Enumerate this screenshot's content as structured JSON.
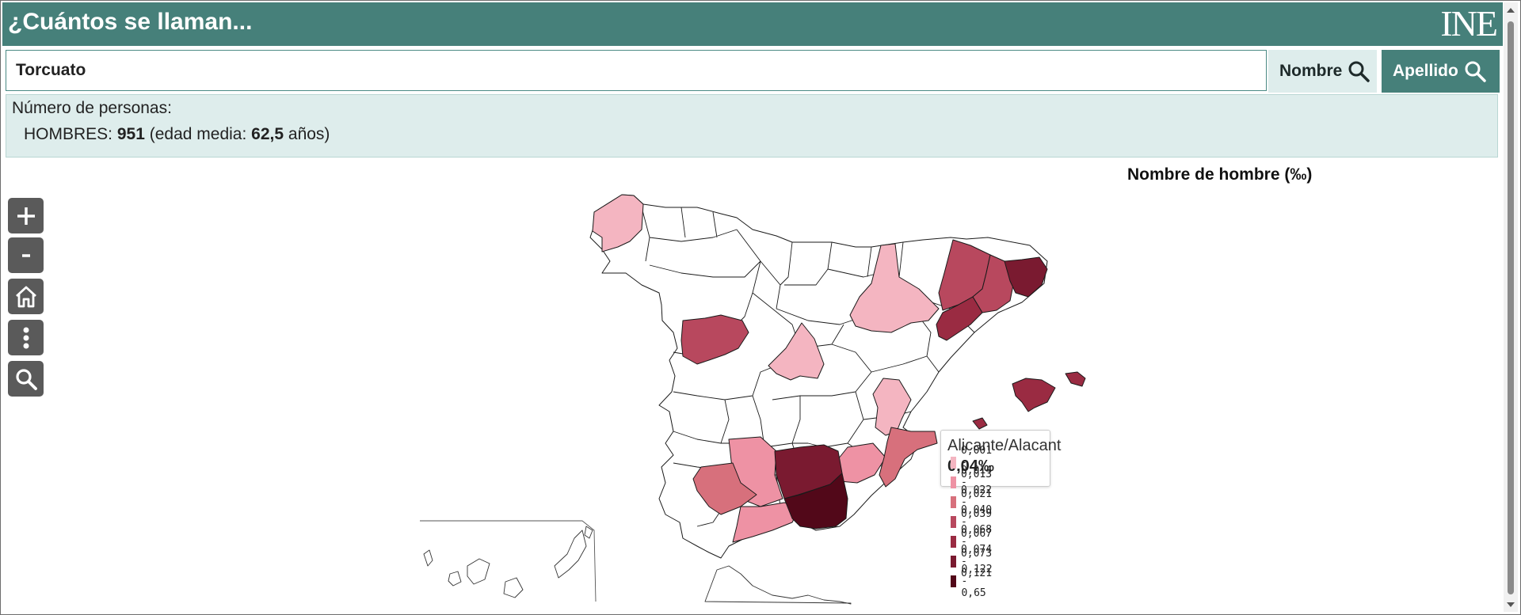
{
  "header": {
    "title": "¿Cuántos se llaman...",
    "logo_text": "INE"
  },
  "search": {
    "value": "Torcuato",
    "nombre_label": "Nombre",
    "apellido_label": "Apellido"
  },
  "result": {
    "count_label": "Número de personas:",
    "gender_label": "HOMBRES:",
    "count": "951",
    "age_prefix": "(edad media:",
    "age": "62,5",
    "age_suffix": "años)"
  },
  "map": {
    "title": "Nombre de hombre (‰)",
    "controls": [
      "zoom-in",
      "zoom-out",
      "home",
      "more",
      "search"
    ],
    "tooltip": {
      "place": "Alicante/Alacant",
      "value": "0,04‰"
    },
    "legend": [
      {
        "label": "0,001 - 0,013",
        "color": "#f4b5c1"
      },
      {
        "label": "0,014 - 0,021",
        "color": "#ee92a4"
      },
      {
        "label": "0,022 - 0,039",
        "color": "#d7707c"
      },
      {
        "label": "0,040 - 0,067",
        "color": "#b8485e"
      },
      {
        "label": "0,068 - 0,073",
        "color": "#9a2b42"
      },
      {
        "label": "0,074 - 0,121",
        "color": "#7a1a30"
      },
      {
        "label": "0,122 - 0,65",
        "color": "#520819"
      }
    ]
  },
  "colors": {
    "header": "#46807a",
    "panel": "#deedec"
  }
}
